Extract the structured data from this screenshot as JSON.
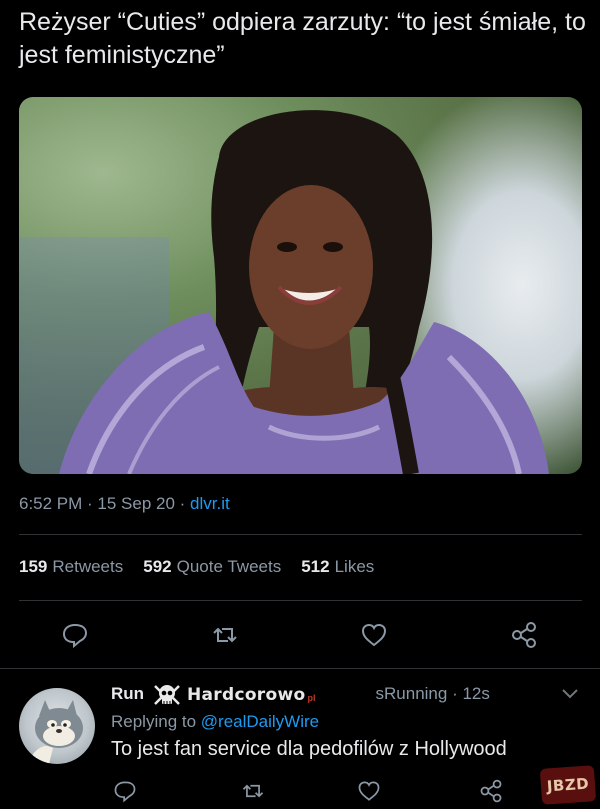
{
  "headline": "Reżyser “Cuties” odpiera zarzuty: “to jest śmiałe, to jest feministyczne”",
  "tweet": {
    "time": "6:52 PM · 15 Sep 20 · ",
    "source": "dlvr.it",
    "stats": {
      "retweets_count": "159",
      "retweets_label": "Retweets",
      "quotes_count": "592",
      "quotes_label": "Quote Tweets",
      "likes_count": "512",
      "likes_label": "Likes"
    },
    "actions": [
      "reply-icon",
      "retweet-icon",
      "like-icon",
      "share-icon"
    ]
  },
  "reply": {
    "name_fragment": "Run",
    "handle_fragment": "sRunning · 12s",
    "replying_prefix": "Replying to ",
    "replying_handle": "@realDailyWire",
    "text": "To jest fan service dla pedofilów z Hollywood"
  },
  "watermark": {
    "text": "Hardcorowo",
    "tld": "pl"
  },
  "corner_badge": "JBZD",
  "colors": {
    "background": "#000000",
    "text": "#e7e9ea",
    "muted": "#8b98a5",
    "accent": "#1d9bf0",
    "divider": "#2f3336"
  }
}
